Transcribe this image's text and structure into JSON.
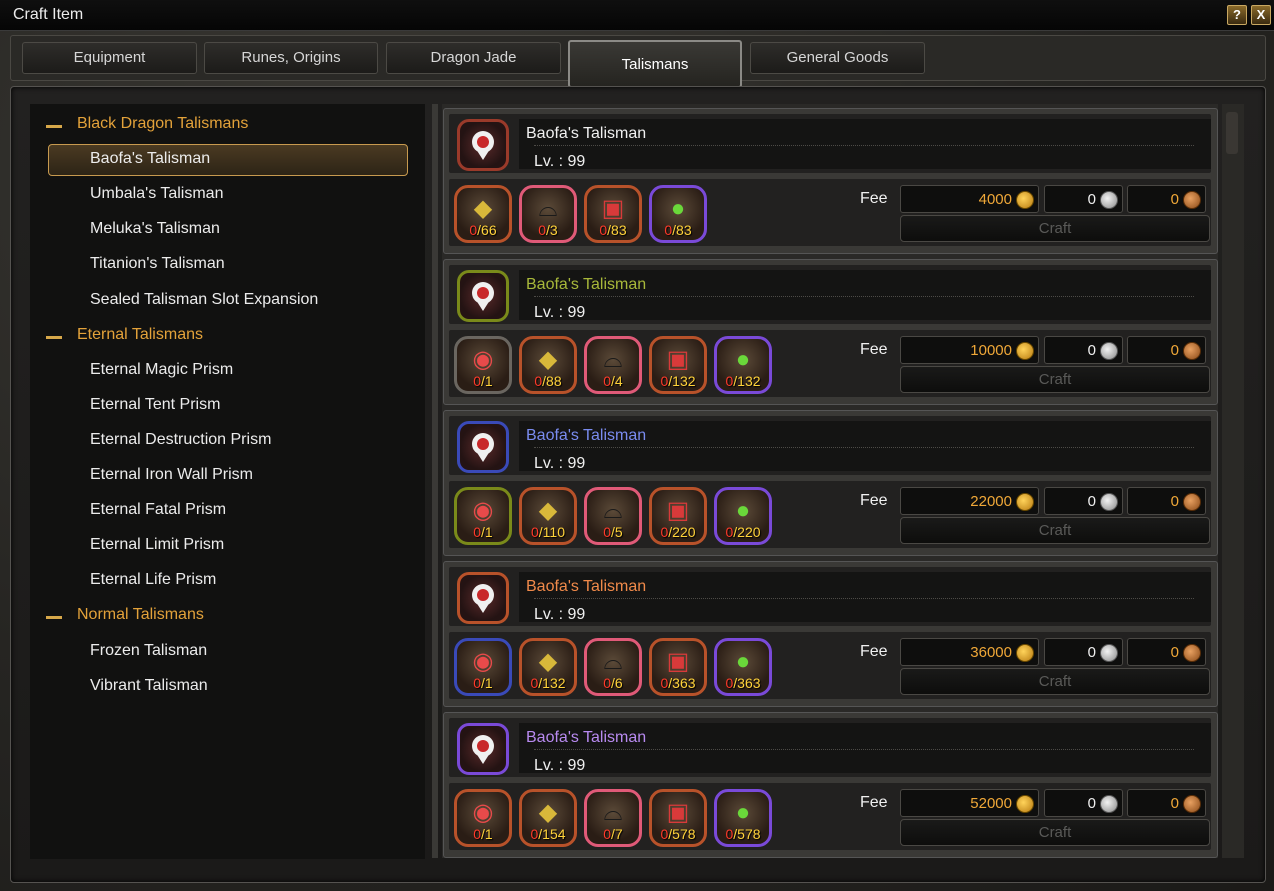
{
  "window": {
    "title": "Craft Item",
    "help_label": "?",
    "close_label": "X"
  },
  "tabs": [
    {
      "label": "Equipment",
      "active": false
    },
    {
      "label": "Runes, Origins",
      "active": false
    },
    {
      "label": "Dragon Jade",
      "active": false
    },
    {
      "label": "Talismans",
      "active": true
    },
    {
      "label": "General Goods",
      "active": false
    }
  ],
  "tree": {
    "categories": [
      {
        "label": "Black Dragon Talismans",
        "items": [
          "Baofa's Talisman",
          "Umbala's Talisman",
          "Meluka's Talisman",
          "Titanion's Talisman",
          "Sealed Talisman Slot Expansion"
        ]
      },
      {
        "label": "Eternal Talismans",
        "items": [
          "Eternal Magic Prism",
          "Eternal Tent Prism",
          "Eternal Destruction Prism",
          "Eternal Iron Wall Prism",
          "Eternal Fatal Prism",
          "Eternal Limit Prism",
          "Eternal Life Prism"
        ]
      },
      {
        "label": "Normal Talismans",
        "items": [
          "Frozen Talisman",
          "Vibrant Talisman"
        ]
      }
    ],
    "selected": "Baofa's Talisman"
  },
  "labels": {
    "fee": "Fee",
    "craft": "Craft",
    "lv_prefix": "Lv. : "
  },
  "recipes": [
    {
      "name": "Baofa's Talisman",
      "name_color": "#f0f0f0",
      "level": "99",
      "icon_border": "#9a3a2a",
      "fee_gold": "4000",
      "fee_silver": "0",
      "fee_copper": "0",
      "materials": [
        {
          "icon": "shard-icon",
          "border": "#b8522a",
          "have": "0",
          "need": "/66"
        },
        {
          "icon": "hat-icon",
          "border": "#e05a78",
          "have": "0",
          "need": "/3"
        },
        {
          "icon": "cube-icon",
          "border": "#b8522a",
          "have": "0",
          "need": "/83"
        },
        {
          "icon": "potion-icon",
          "border": "#7a4ad8",
          "have": "0",
          "need": "/83"
        }
      ]
    },
    {
      "name": "Baofa's Talisman",
      "name_color": "#a8b83a",
      "level": "99",
      "icon_border": "#7a8a1a",
      "fee_gold": "10000",
      "fee_silver": "0",
      "fee_copper": "0",
      "materials": [
        {
          "icon": "talisman-icon",
          "border": "#6a6660",
          "have": "0",
          "need": "/1"
        },
        {
          "icon": "shard-icon",
          "border": "#b8522a",
          "have": "0",
          "need": "/88"
        },
        {
          "icon": "hat-icon",
          "border": "#e05a78",
          "have": "0",
          "need": "/4"
        },
        {
          "icon": "cube-icon",
          "border": "#b8522a",
          "have": "0",
          "need": "/132"
        },
        {
          "icon": "potion-icon",
          "border": "#7a4ad8",
          "have": "0",
          "need": "/132"
        }
      ]
    },
    {
      "name": "Baofa's Talisman",
      "name_color": "#7a8cf0",
      "level": "99",
      "icon_border": "#3a4ab8",
      "fee_gold": "22000",
      "fee_silver": "0",
      "fee_copper": "0",
      "materials": [
        {
          "icon": "talisman-icon",
          "border": "#7a8a1a",
          "have": "0",
          "need": "/1"
        },
        {
          "icon": "shard-icon",
          "border": "#b8522a",
          "have": "0",
          "need": "/110"
        },
        {
          "icon": "hat-icon",
          "border": "#e05a78",
          "have": "0",
          "need": "/5"
        },
        {
          "icon": "cube-icon",
          "border": "#b8522a",
          "have": "0",
          "need": "/220"
        },
        {
          "icon": "potion-icon",
          "border": "#7a4ad8",
          "have": "0",
          "need": "/220"
        }
      ]
    },
    {
      "name": "Baofa's Talisman",
      "name_color": "#f08a4a",
      "level": "99",
      "icon_border": "#b8522a",
      "fee_gold": "36000",
      "fee_silver": "0",
      "fee_copper": "0",
      "materials": [
        {
          "icon": "talisman-icon",
          "border": "#3a4ab8",
          "have": "0",
          "need": "/1"
        },
        {
          "icon": "shard-icon",
          "border": "#b8522a",
          "have": "0",
          "need": "/132"
        },
        {
          "icon": "hat-icon",
          "border": "#e05a78",
          "have": "0",
          "need": "/6"
        },
        {
          "icon": "cube-icon",
          "border": "#b8522a",
          "have": "0",
          "need": "/363"
        },
        {
          "icon": "potion-icon",
          "border": "#7a4ad8",
          "have": "0",
          "need": "/363"
        }
      ]
    },
    {
      "name": "Baofa's Talisman",
      "name_color": "#b88af0",
      "level": "99",
      "icon_border": "#7a4ad8",
      "fee_gold": "52000",
      "fee_silver": "0",
      "fee_copper": "0",
      "materials": [
        {
          "icon": "talisman-icon",
          "border": "#b8522a",
          "have": "0",
          "need": "/1"
        },
        {
          "icon": "shard-icon",
          "border": "#b8522a",
          "have": "0",
          "need": "/154"
        },
        {
          "icon": "hat-icon",
          "border": "#e05a78",
          "have": "0",
          "need": "/7"
        },
        {
          "icon": "cube-icon",
          "border": "#b8522a",
          "have": "0",
          "need": "/578"
        },
        {
          "icon": "potion-icon",
          "border": "#7a4ad8",
          "have": "0",
          "need": "/578"
        }
      ]
    }
  ]
}
